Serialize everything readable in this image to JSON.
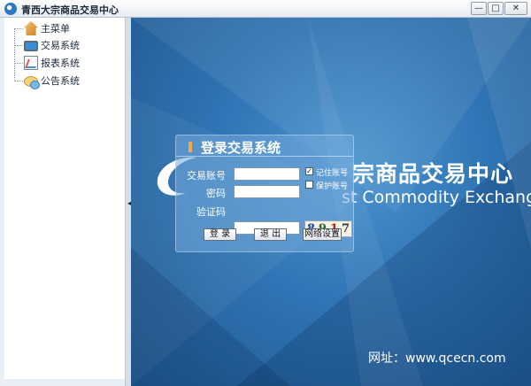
{
  "window": {
    "title": "青西大宗商品交易中心",
    "controls": {
      "minimize": "—",
      "maximize": "□",
      "close": "✕"
    }
  },
  "sidebar": {
    "items": [
      {
        "label": "主菜单",
        "icon": "home-icon"
      },
      {
        "label": "交易系统",
        "icon": "monitor-icon"
      },
      {
        "label": "报表系统",
        "icon": "chart-icon"
      },
      {
        "label": "公告系统",
        "icon": "chat-bubble-icon"
      }
    ],
    "collapse_arrow": "◂"
  },
  "background": {
    "title_cn": "宗商品交易中心",
    "title_en": "st Commodity Exchange",
    "url": "网址：www.qcecn.com"
  },
  "login": {
    "title": "登录交易系统",
    "account_label": "交易账号",
    "password_label": "密码",
    "captcha_label": "验证码",
    "account_value": "",
    "password_value": "",
    "captcha_value": "",
    "remember_label": "记住账号",
    "remember_checked": true,
    "protect_label": "保护账号",
    "protect_checked": false,
    "captcha_digits": [
      "8",
      "9",
      "1",
      "7"
    ],
    "captcha_colors": [
      "#1f3f9a",
      "#2a6a2a",
      "#b02a1a",
      "#3a3a3a"
    ],
    "buttons": {
      "login": "登 录",
      "exit": "退 出",
      "network": "网络设置"
    }
  }
}
